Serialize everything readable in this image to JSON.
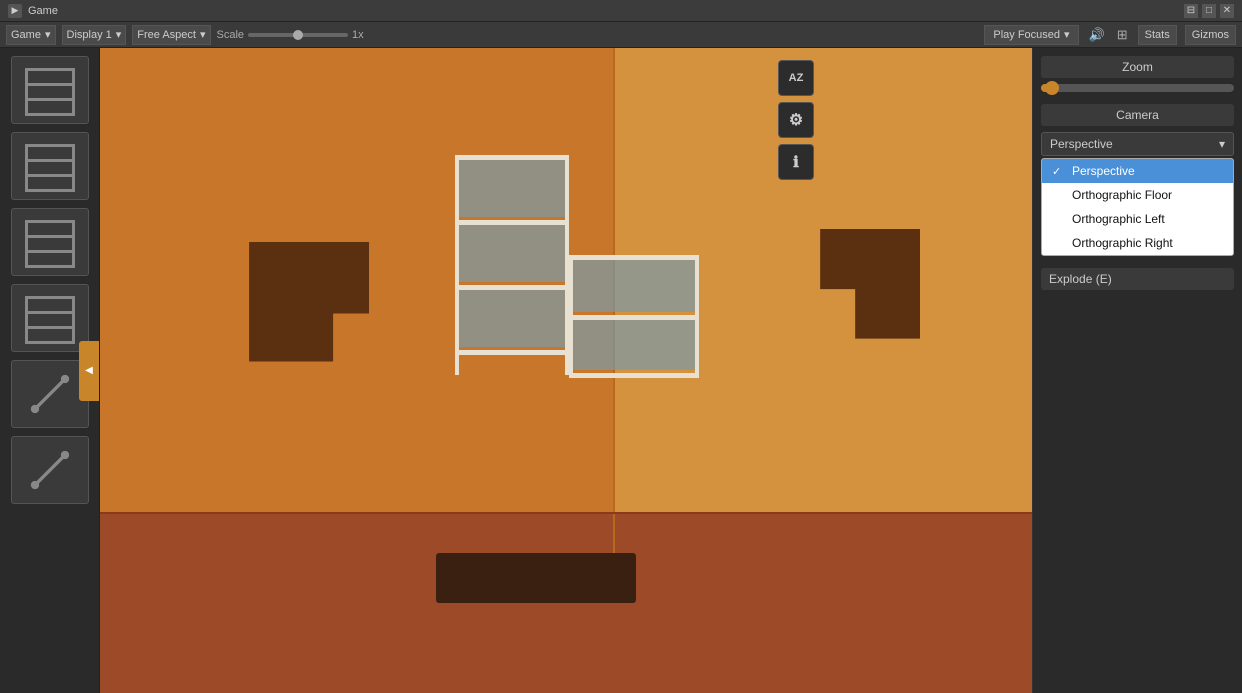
{
  "titleBar": {
    "title": "Game",
    "icon": "▶",
    "controls": [
      "⊟",
      "□",
      "✕"
    ]
  },
  "toolbar": {
    "gameLabel": "Game",
    "display": "Display 1",
    "aspect": "Free Aspect",
    "scaleLabel": "Scale",
    "scaleValue": "1x",
    "playFocused": "Play Focused",
    "stats": "Stats",
    "gizmos": "Gizmos"
  },
  "leftPanel": {
    "items": [
      {
        "id": 1,
        "label": "shelf-item-1"
      },
      {
        "id": 2,
        "label": "shelf-item-2"
      },
      {
        "id": 3,
        "label": "shelf-item-3"
      },
      {
        "id": 4,
        "label": "shelf-item-4"
      },
      {
        "id": 5,
        "label": "bolt-item-1"
      },
      {
        "id": 6,
        "label": "bolt-item-2"
      }
    ]
  },
  "rightPanel": {
    "azButton": "AZ",
    "gearButton": "⚙",
    "infoButton": "ℹ",
    "zoom": {
      "label": "Zoom",
      "value": 5
    },
    "camera": {
      "label": "Camera",
      "selected": "Perspective",
      "options": [
        {
          "label": "Perspective",
          "selected": true
        },
        {
          "label": "Orthographic Floor",
          "selected": false
        },
        {
          "label": "Orthographic Left",
          "selected": false
        },
        {
          "label": "Orthographic Right",
          "selected": false
        }
      ]
    },
    "explode": {
      "label": "Explode (E)"
    }
  },
  "viewport": {
    "rugColor": "#3a2010",
    "shadowLeftColor": "#5a3010",
    "shadowRightColor": "#5a3010"
  }
}
